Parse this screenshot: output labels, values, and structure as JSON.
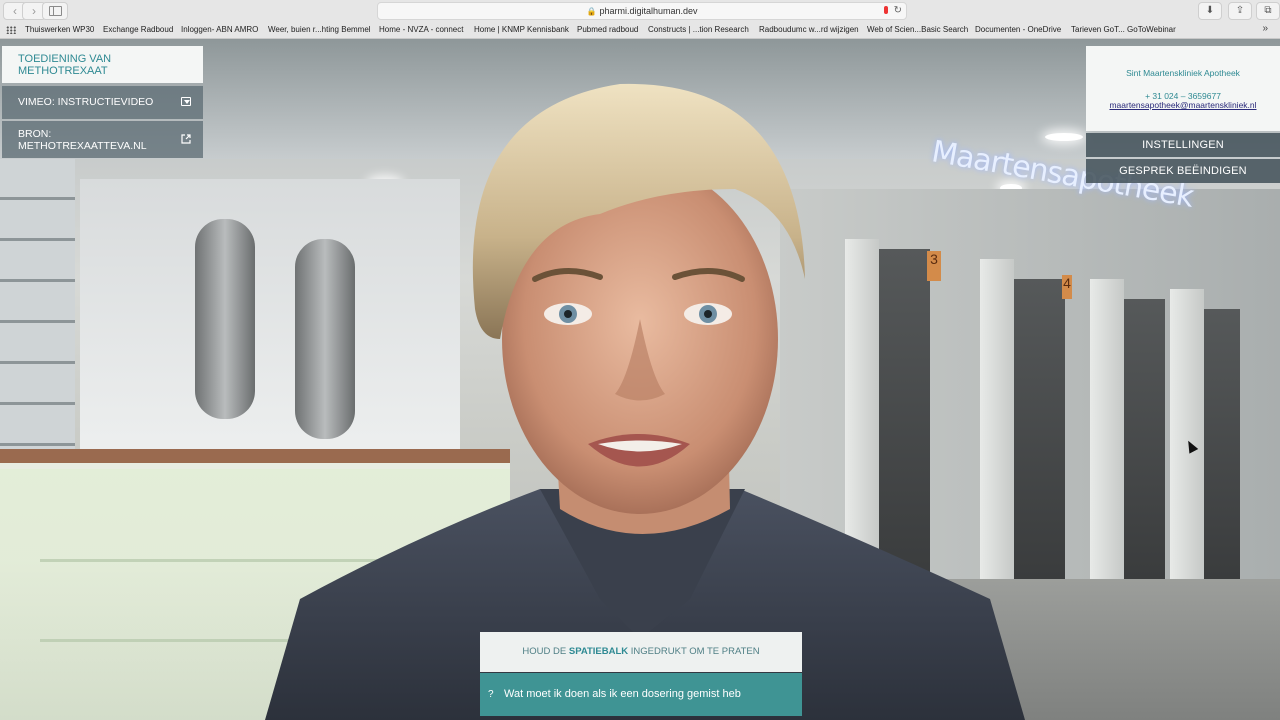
{
  "browser": {
    "url": "pharmi.digitalhuman.dev",
    "bookmarks": [
      "Thuiswerken WP30",
      "Exchange Radboud",
      "Inloggen- ABN AMRO",
      "Weer, buien r...hting Bemmel",
      "Home - NVZA - connect",
      "Home | KNMP Kennisbank",
      "Pubmed radboud",
      "Constructs | ...tion Research",
      "Radboudumc w...rd wijzigen",
      "Web of Scien...Basic Search",
      "Documenten - OneDrive",
      "Tarieven GoT... GoToWebinar"
    ],
    "more_glyph": "»"
  },
  "left_panel": {
    "title": "TOEDIENING VAN METHOTREXAAT",
    "video_link": "VIMEO: INSTRUCTIEVIDEO",
    "source_link": "BRON: METHOTREXAATTEVA.NL"
  },
  "scene": {
    "sign": "Maartensapotheek",
    "door_number_1": "3",
    "door_number_2": "4"
  },
  "right_panel": {
    "pharmacy_name": "Sint Maartenskliniek Apotheek",
    "phone": "+ 31 024 – 3659677",
    "email": "maartensapotheek@maartenskliniek.nl",
    "settings_button": "INSTELLINGEN",
    "end_button": "GESPREK BEËINDIGEN"
  },
  "bottom": {
    "hint_prefix": "HOUD DE",
    "hint_key": "SPATIEBALK",
    "hint_suffix": "INGEDRUKT OM TE PRATEN",
    "query_mark": "?",
    "query_text": "Wat moet ik doen als ik een dosering gemist heb"
  },
  "colors": {
    "teal": "#2f8a93",
    "teal_bar": "#3f9494",
    "panel_dark": "#46545c"
  }
}
